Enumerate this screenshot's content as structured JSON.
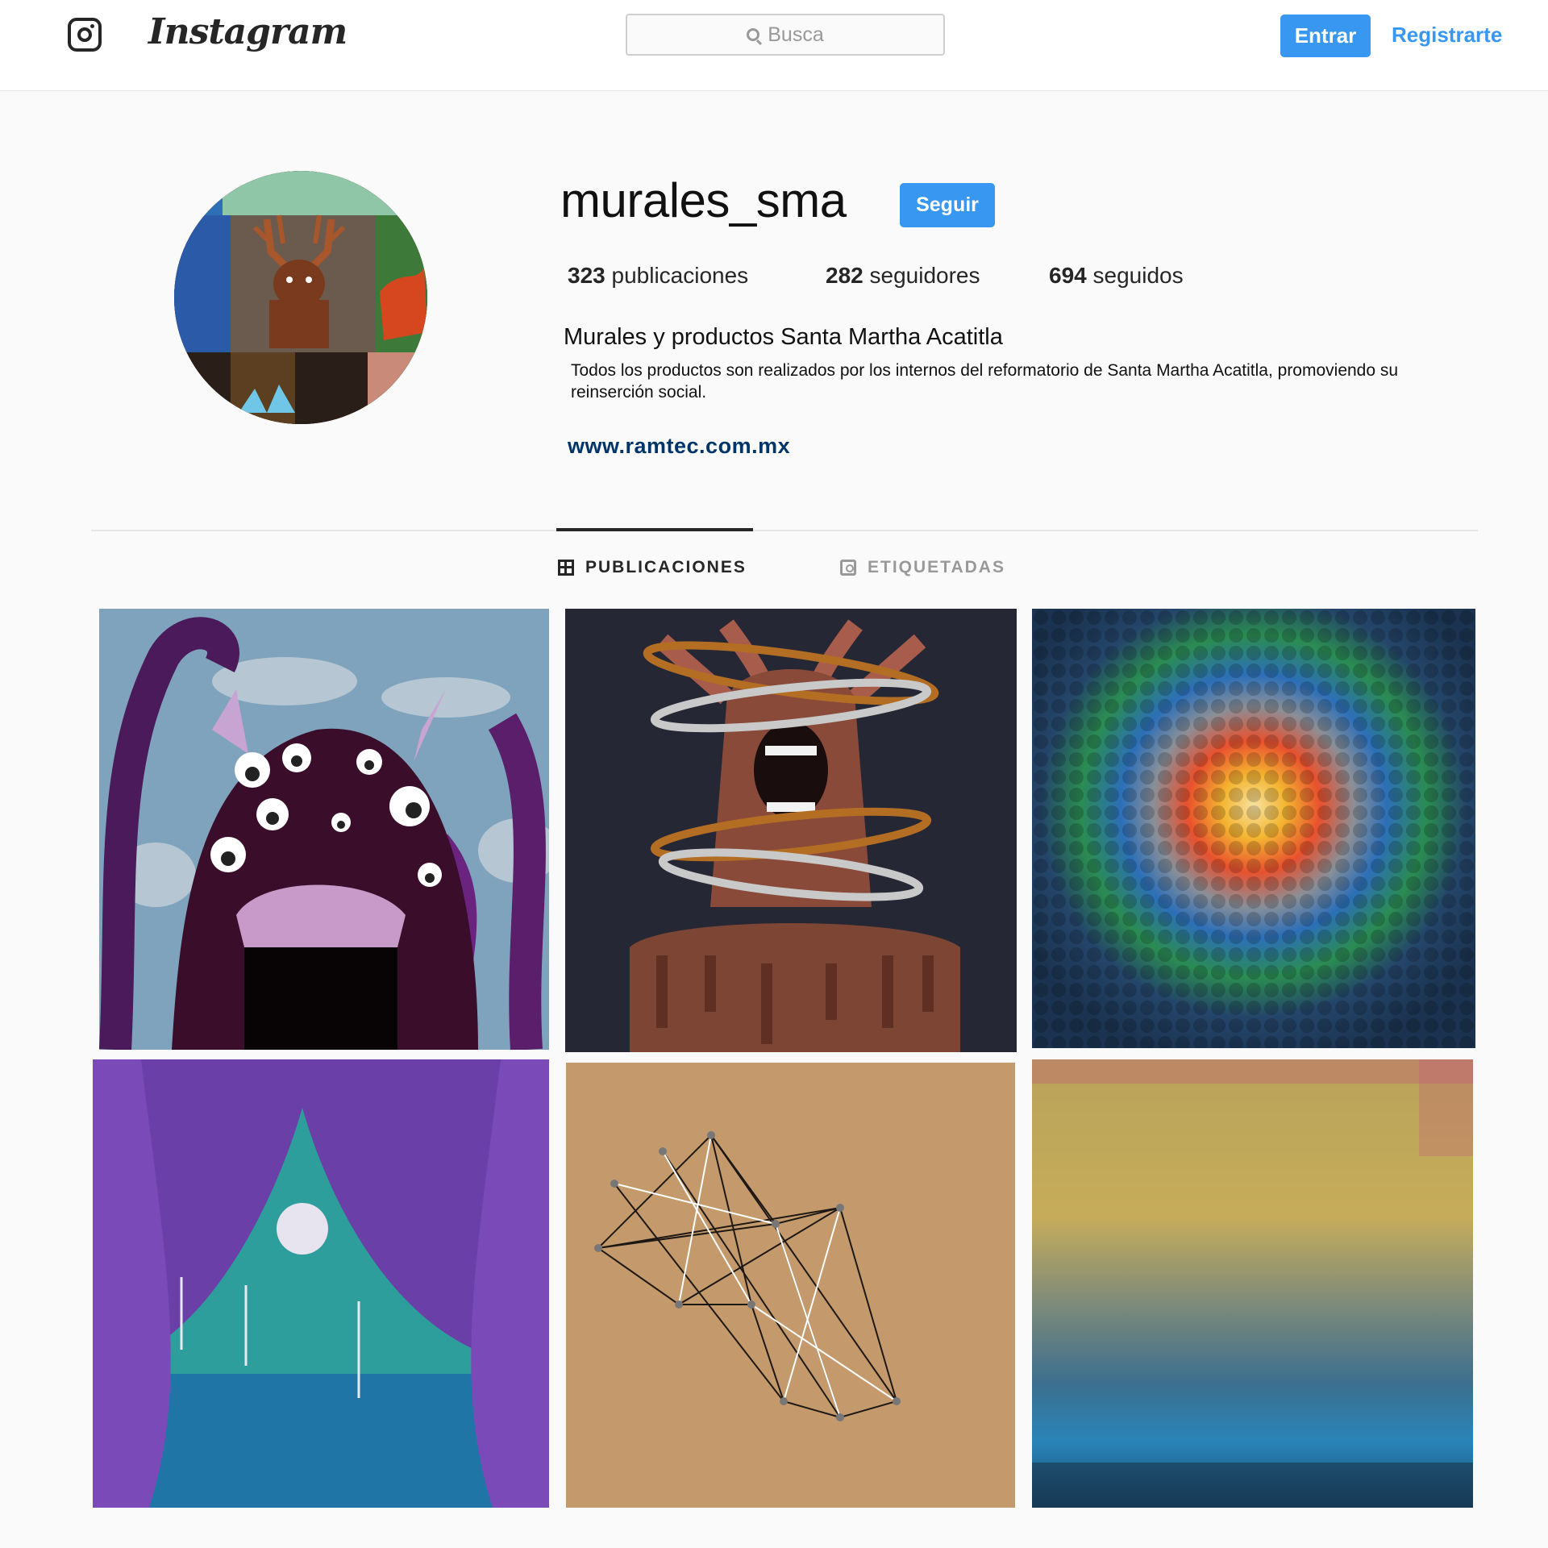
{
  "nav": {
    "logo_icon": "instagram-camera-icon",
    "wordmark": "Instagram",
    "search_placeholder": "Busca",
    "search_icon": "search-icon",
    "login_label": "Entrar",
    "signup_label": "Registrarte",
    "accent_color": "#3897f0"
  },
  "profile": {
    "username": "murales_sma",
    "follow_label": "Seguir",
    "stats": {
      "posts_count": "323",
      "posts_label": "publicaciones",
      "followers_count": "282",
      "followers_label": "seguidores",
      "following_count": "694",
      "following_label": "seguidos"
    },
    "full_name": "Murales y productos Santa Martha Acatitla",
    "bio": "Todos los productos son realizados por los internos del reformatorio de Santa Martha Acatitla, promoviendo su reinserción social.",
    "website": "www.ramtec.com.mx"
  },
  "tabs": [
    {
      "label": "PUBLICACIONES",
      "icon": "grid-icon",
      "active": true
    },
    {
      "label": "ETIQUETADAS",
      "icon": "tagged-icon",
      "active": false
    }
  ],
  "posts": [
    {
      "subject": "purple many-eyed monster with tentacles painting"
    },
    {
      "subject": "screaming figure wrapped in rings painting"
    },
    {
      "subject": "colorful clay dot mosaic"
    },
    {
      "subject": "purple curtain stage with moon painting"
    },
    {
      "subject": "string art on wood board"
    },
    {
      "subject": "abstract gold and blue texture painting"
    }
  ]
}
